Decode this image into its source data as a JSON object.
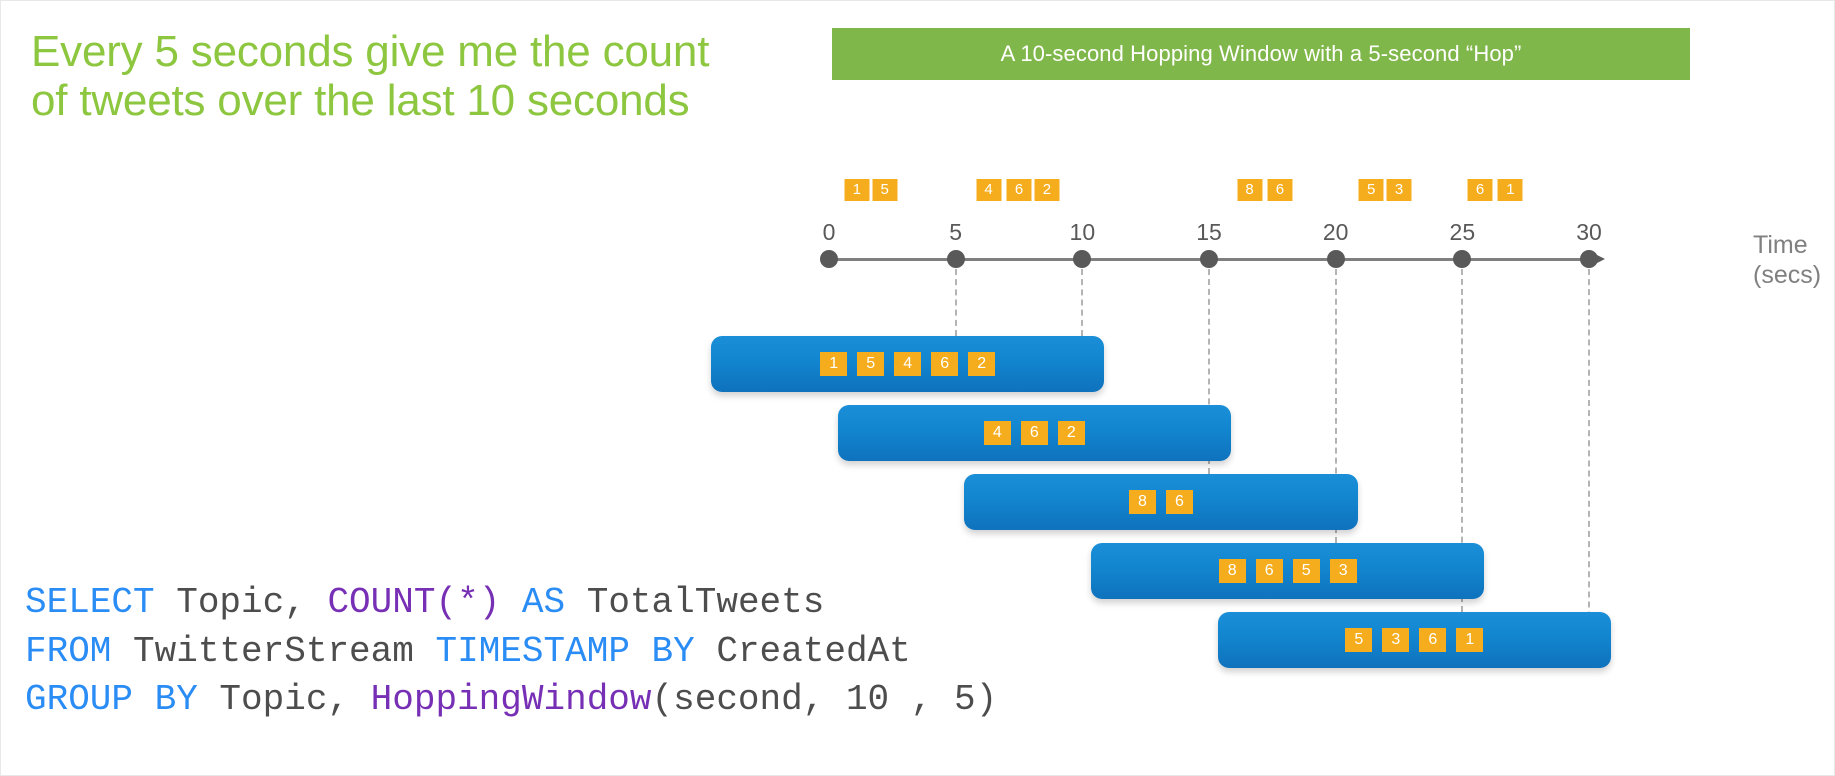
{
  "headline": "Every 5 seconds give me the count of tweets over the last 10 seconds",
  "banner": {
    "title": "A 10-second Hopping Window with a 5-second “Hop”",
    "background_color": "#80b74b",
    "text_color": "#ffffff"
  },
  "colors": {
    "headline_green": "#8dc63f",
    "chip_orange": "#f5ac1d",
    "window_blue": "#1285cf",
    "axis_gray": "#7f7f7f",
    "sql_keyword_blue": "#2a8cf5",
    "sql_function_purple": "#7730b5",
    "sql_identifier_gray": "#4d4d4d"
  },
  "chart_data": {
    "type": "timeline",
    "title": "A 10-second Hopping Window with a 5-second “Hop”",
    "xlabel": "Time (secs)",
    "axis_caption_lines": [
      "Time",
      "(secs)"
    ],
    "xlim": [
      0,
      30
    ],
    "tick_values": [
      0,
      5,
      10,
      15,
      20,
      25,
      30
    ],
    "tick_labels": [
      "0",
      "5",
      "10",
      "15",
      "20",
      "25",
      "30"
    ],
    "grid": false,
    "legend": "none",
    "events": [
      {
        "label": "1",
        "t": 1.1
      },
      {
        "label": "5",
        "t": 2.2
      },
      {
        "label": "4",
        "t": 6.3
      },
      {
        "label": "6",
        "t": 7.5
      },
      {
        "label": "2",
        "t": 8.6
      },
      {
        "label": "8",
        "t": 16.6
      },
      {
        "label": "6",
        "t": 17.8
      },
      {
        "label": "5",
        "t": 21.4
      },
      {
        "label": "3",
        "t": 22.5
      },
      {
        "label": "6",
        "t": 25.7
      },
      {
        "label": "1",
        "t": 26.9
      }
    ],
    "windows": [
      {
        "start": 0,
        "end": 10,
        "tweets": [
          "1",
          "5",
          "4",
          "6",
          "2"
        ],
        "count": 5
      },
      {
        "start": 5,
        "end": 15,
        "tweets": [
          "4",
          "6",
          "2"
        ],
        "count": 3
      },
      {
        "start": 10,
        "end": 20,
        "tweets": [
          "8",
          "6"
        ],
        "count": 2
      },
      {
        "start": 15,
        "end": 25,
        "tweets": [
          "8",
          "6",
          "5",
          "3"
        ],
        "count": 4
      },
      {
        "start": 20,
        "end": 30,
        "tweets": [
          "5",
          "3",
          "6",
          "1"
        ],
        "count": 4
      }
    ]
  },
  "sql": {
    "lines": [
      [
        {
          "text": "SELECT",
          "style": "kw-blue"
        },
        {
          "text": " Topic, ",
          "style": "kw-plain"
        },
        {
          "text": "COUNT(*)",
          "style": "kw-purple"
        },
        {
          "text": " ",
          "style": "kw-plain"
        },
        {
          "text": "AS",
          "style": "kw-blue"
        },
        {
          "text": " TotalTweets",
          "style": "kw-plain"
        }
      ],
      [
        {
          "text": "FROM",
          "style": "kw-blue"
        },
        {
          "text": " TwitterStream ",
          "style": "kw-plain"
        },
        {
          "text": "TIMESTAMP BY",
          "style": "kw-blue"
        },
        {
          "text": " CreatedAt",
          "style": "kw-plain"
        }
      ],
      [
        {
          "text": "GROUP BY",
          "style": "kw-blue"
        },
        {
          "text": " Topic, ",
          "style": "kw-plain"
        },
        {
          "text": "HoppingWindow",
          "style": "kw-purple"
        },
        {
          "text": "(second, 10 , 5)",
          "style": "kw-plain"
        }
      ]
    ]
  }
}
